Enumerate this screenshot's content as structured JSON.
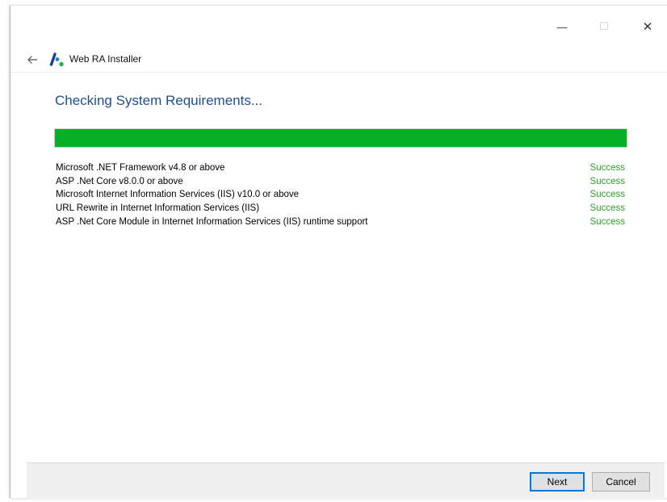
{
  "window": {
    "title": "Web RA Installer",
    "minimize_glyph": "—",
    "maximize_glyph": "☐",
    "close_glyph": "✕"
  },
  "page": {
    "heading": "Checking System Requirements..."
  },
  "progress": {
    "percent": 100,
    "color": "#06b025"
  },
  "requirements": [
    {
      "name": "Microsoft .NET Framework v4.8 or above",
      "status": "Success"
    },
    {
      "name": "ASP .Net Core v8.0.0 or above",
      "status": "Success"
    },
    {
      "name": "Microsoft Internet Information Services (IIS) v10.0 or above",
      "status": "Success"
    },
    {
      "name": "URL Rewrite in Internet Information Services (IIS)",
      "status": "Success"
    },
    {
      "name": "ASP .Net Core Module in Internet Information Services (IIS) runtime support",
      "status": "Success"
    }
  ],
  "footer": {
    "next_label": "Next",
    "cancel_label": "Cancel"
  },
  "colors": {
    "heading": "#1d4f8f",
    "success": "#2ca02c",
    "default_button_border": "#0078d7"
  },
  "icons": [
    "back-arrow-icon",
    "app-logo-icon",
    "minimize-icon",
    "maximize-icon",
    "close-icon"
  ]
}
